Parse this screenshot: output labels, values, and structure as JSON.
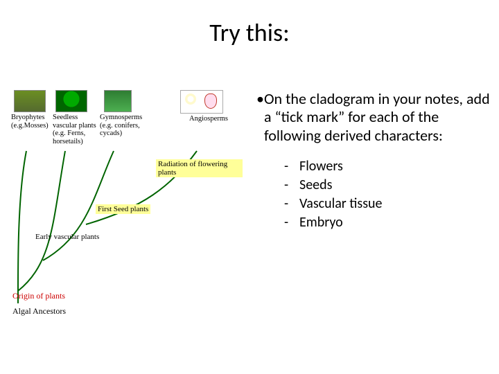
{
  "slide": {
    "title": "Try this:",
    "bullet_main": "On the cladogram in your notes, add a “tick mark” for each of the following derived characters:",
    "sub_bullets": [
      "Flowers",
      "Seeds",
      "Vascular tissue",
      "Embryo"
    ]
  },
  "cladogram": {
    "taxa": {
      "bryophytes": "Bryophytes (e.g.Mosses)",
      "seedless": "Seedless vascular plants (e.g. Ferns, horsetails)",
      "gymnosperms": "Gymnosperms (e.g. conifers, cycads)",
      "angiosperms": "Angiosperms"
    },
    "node_labels": {
      "flowering": "Radiation of flowering plants",
      "seed": "First Seed plants",
      "vascular": "Early vascular plants"
    },
    "root": "Origin of plants",
    "outgroup": "Algal Ancestors"
  }
}
